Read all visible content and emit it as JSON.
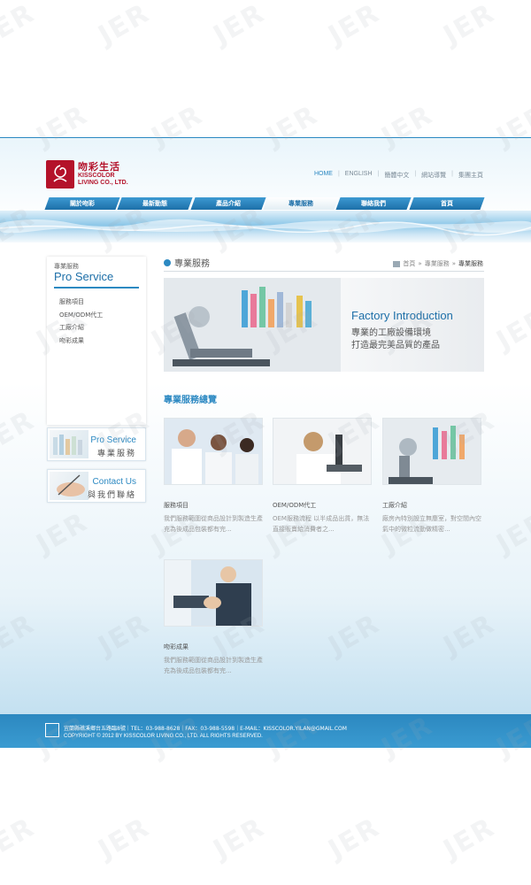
{
  "header": {
    "logo_cn": "吻彩生活",
    "logo_en1": "KISSCOLOR",
    "logo_en2": "LIVING CO., LTD.",
    "topnav": [
      "HOME",
      "ENGLISH",
      "簡體中文",
      "網站導覽",
      "集團主頁"
    ]
  },
  "mainnav": [
    "關於吻彩",
    "最新動態",
    "產品介紹",
    "專業服務",
    "聯絡我們",
    "首頁"
  ],
  "sidebar": {
    "small_title": "專業服務",
    "title": "Pro Service",
    "items": [
      "服務項目",
      "OEM/ODM代工",
      "工廠介紹",
      "吻彩成果"
    ],
    "btn1_en": "Pro Service",
    "btn1_cn": "專業服務",
    "btn2_en": "Contact Us",
    "btn2_cn": "與我們聯絡"
  },
  "content": {
    "title": "專業服務",
    "breadcrumb": [
      "首頁",
      "»",
      "專業服務",
      "»",
      "專業服務"
    ],
    "banner_en": "Factory Introduction",
    "banner_cn1": "專業的工廠設備環境",
    "banner_cn2": "打造最完美品質的產品",
    "section_title": "專業服務總覽",
    "cards": [
      {
        "title": "服務項目",
        "desc": "我們服務範圍從商品設計到製造生產充為後成品包裝都有完..."
      },
      {
        "title": "OEM/ODM代工",
        "desc": "OEM服務流程 以半成品出貨，無法直接販賣給消費者之..."
      },
      {
        "title": "工廠介紹",
        "desc": "廠房內特別設立無塵室，對空間內空氣中的微粒流動做精密..."
      },
      {
        "title": "吻彩成果",
        "desc": "我們服務範圍從商品設計到製造生產充為後成品包裝都有完..."
      }
    ]
  },
  "footer": {
    "line1": "宜蘭縣礁溪鄉台五路臨8號｜TEL：03-988-8628｜FAX：03-988-5598｜E-MAIL：KISSCOLOR.YILAN@GMAIL.COM",
    "line2": "COPYRIGHT © 2012 BY KISSCOLOR LIVING CO., LTD. ALL RIGHTS RESERVED."
  },
  "watermark": "JER",
  "colors": {
    "primary": "#2c89c2",
    "brand_red": "#b4122a"
  }
}
